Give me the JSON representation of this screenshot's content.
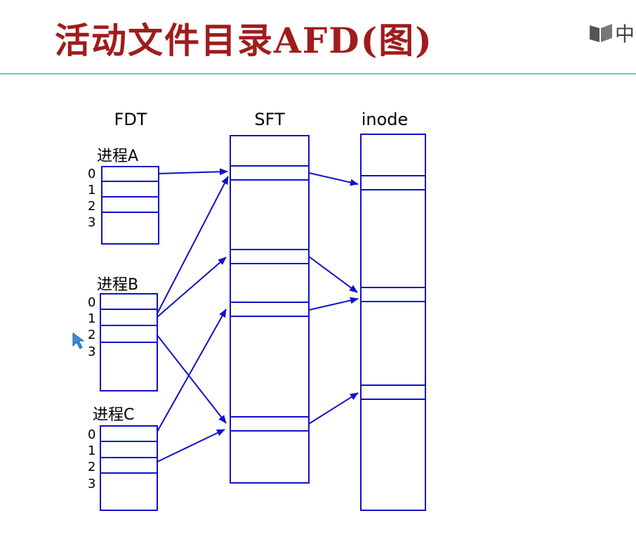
{
  "title": "活动文件目录AFD(图)",
  "logo": {
    "text": "中",
    "icon": "book-logo-icon"
  },
  "columns": {
    "fdt": "FDT",
    "sft": "SFT",
    "inode": "inode"
  },
  "processes": [
    {
      "id": "A",
      "label": "进程A",
      "slots": [
        "0",
        "1",
        "2",
        "3"
      ]
    },
    {
      "id": "B",
      "label": "进程B",
      "slots": [
        "0",
        "1",
        "2",
        "3"
      ]
    },
    {
      "id": "C",
      "label": "进程C",
      "slots": [
        "0",
        "1",
        "2",
        "3"
      ]
    }
  ],
  "colors": {
    "title": "#a01c1c",
    "diagram": "#1010c8",
    "rule": "#7fb8c4",
    "cursor": "#3a8fd6"
  },
  "links": [
    {
      "from": "A.0",
      "to": "SFT.1"
    },
    {
      "from": "B.0",
      "to": "SFT.1"
    },
    {
      "from": "B.1",
      "to": "SFT.2"
    },
    {
      "from": "B.2",
      "to": "SFT.4"
    },
    {
      "from": "C.0",
      "to": "SFT.3"
    },
    {
      "from": "C.2",
      "to": "SFT.4"
    },
    {
      "from": "SFT.1",
      "to": "inode.1"
    },
    {
      "from": "SFT.2",
      "to": "inode.2"
    },
    {
      "from": "SFT.3",
      "to": "inode.2"
    },
    {
      "from": "SFT.4",
      "to": "inode.3"
    }
  ]
}
